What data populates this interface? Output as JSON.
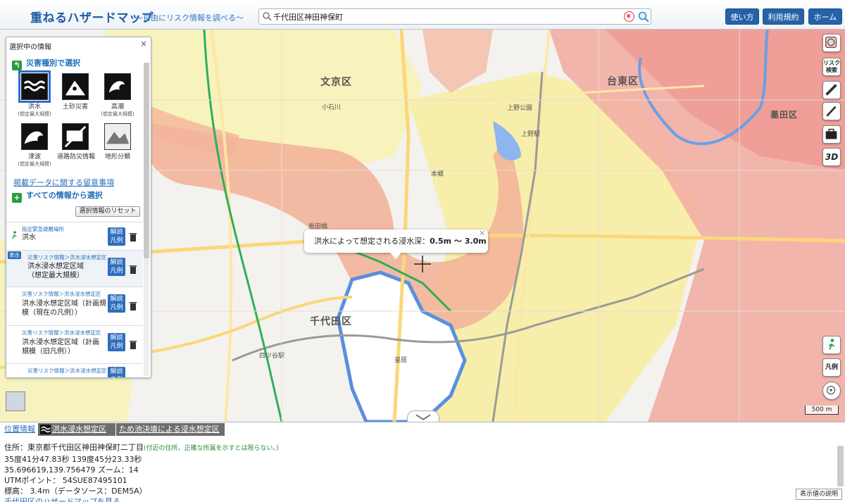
{
  "header": {
    "logo": "重ねるハザードマップ",
    "tagline": "～自由にリスク情報を調べる～",
    "search_value": "千代田区神田神保町",
    "buttons": [
      "使い方",
      "利用規約",
      "ホーム"
    ]
  },
  "panel": {
    "title": "選択中の情報",
    "close": "×",
    "section1": "災害種別で選択",
    "section2": "すべての情報から選択",
    "hazards": [
      {
        "label": "洪水",
        "sub": "(想定最大規模)",
        "icon": "flood-icon"
      },
      {
        "label": "土砂災害",
        "sub": "",
        "icon": "landslide-icon"
      },
      {
        "label": "高潮",
        "sub": "(想定最大規模)",
        "icon": "storm-surge-icon"
      },
      {
        "label": "津波",
        "sub": "(想定最大規模)",
        "icon": "tsunami-icon"
      },
      {
        "label": "道路防災情報",
        "sub": "",
        "icon": "road-disaster-icon"
      },
      {
        "label": "地形分類",
        "sub": "",
        "icon": "landform-icon"
      }
    ],
    "notice_link": "掲載データに関する留意事項",
    "reset_button": "選択情報のリセット",
    "items": [
      {
        "category": "指定緊急避難場所",
        "name": "洪水",
        "badge": ""
      },
      {
        "category": "災害リスク情報＞洪水浸水想定区",
        "name": "洪水浸水想定区域\n（想定最大規模）",
        "badge": "表示"
      },
      {
        "category": "災害リスク情報＞洪水浸水想定区",
        "name": "洪水浸水想定区域（計画規\n模（現在の凡例））",
        "badge": ""
      },
      {
        "category": "災害リスク情報＞洪水浸水想定区",
        "name": "洪水浸水想定区域（計画\n規模（旧凡例））",
        "badge": ""
      },
      {
        "category": "災害リスク情報＞洪水浸水想定区",
        "name": "",
        "badge": ""
      }
    ],
    "item_button": "解説\n凡例"
  },
  "map": {
    "labels": [
      "文京区",
      "台東区",
      "千代田区",
      "皇居",
      "小石川",
      "上野公園",
      "上野駅",
      "飯田橋",
      "四ツ谷駅",
      "墨田区",
      "本郷"
    ],
    "popup_text": "洪水によって想定される浸水深：",
    "popup_value": "0.5m 〜 3.0m",
    "scale": "500 m",
    "legend_button": "凡例"
  },
  "right_tools": [
    "layers-icon",
    "risk-search-icon",
    "ruler-icon",
    "pencil-icon",
    "toolbox-icon",
    "3d-icon"
  ],
  "right_tools_text": {
    "risk": "リスク\n検索",
    "threed": "3D"
  },
  "bottom": {
    "tabs": [
      "位置情報",
      "洪水浸水想定区域",
      "ため池決壊による浸水想定区域"
    ],
    "address_label": "住所：東京都千代田区神田神保町二丁目",
    "address_note": "(付近の住所。正確な所属を示すとは限らない。)",
    "dms": "35度41分47.83秒 139度45分23.33秒",
    "latlon_zoom": "35.696619,139.756479  ズーム：14",
    "utm": "UTMポイント： 54SUE87495101",
    "elevation": "標高： 3.4m（データソース：DEM5A）",
    "hazard_link": "千代田区のハザードマップを見る",
    "explain_button": "表示値の説明"
  },
  "colors": {
    "accent": "#2563a8",
    "flood_pink": "#f4a8a0",
    "flood_yellow": "#f7ef9a",
    "flood_orange": "#f6c99a"
  }
}
